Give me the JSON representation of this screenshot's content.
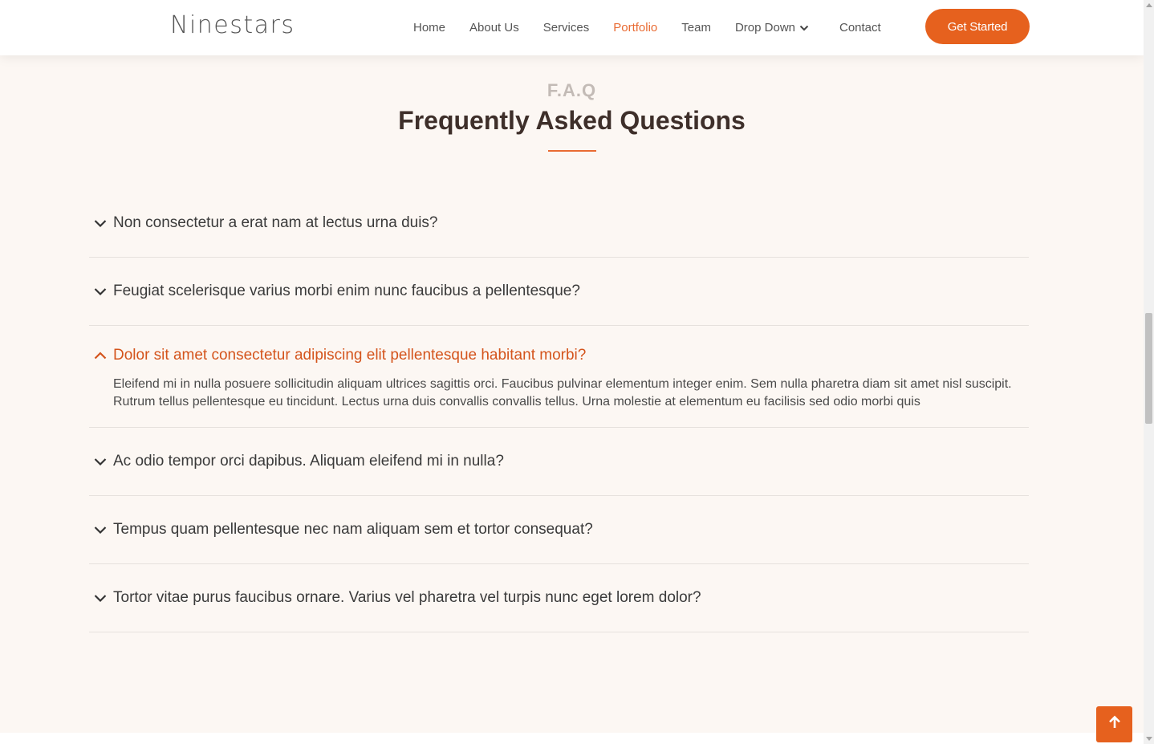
{
  "header": {
    "logo": "Ninestars",
    "nav": [
      {
        "label": "Home",
        "active": false
      },
      {
        "label": "About Us",
        "active": false
      },
      {
        "label": "Services",
        "active": false
      },
      {
        "label": "Portfolio",
        "active": true
      },
      {
        "label": "Team",
        "active": false
      },
      {
        "label": "Drop Down",
        "active": false,
        "icon": "chevron-down-icon"
      },
      {
        "label": "Contact",
        "active": false
      }
    ],
    "cta_label": "Get Started"
  },
  "section": {
    "kicker": "F.A.Q",
    "title": "Frequently Asked Questions"
  },
  "faq": [
    {
      "question": "Non consectetur a erat nam at lectus urna duis?",
      "open": false
    },
    {
      "question": "Feugiat scelerisque varius morbi enim nunc faucibus a pellentesque?",
      "open": false
    },
    {
      "question": "Dolor sit amet consectetur adipiscing elit pellentesque habitant morbi?",
      "open": true,
      "answer": "Eleifend mi in nulla posuere sollicitudin aliquam ultrices sagittis orci. Faucibus pulvinar elementum integer enim. Sem nulla pharetra diam sit amet nisl suscipit. Rutrum tellus pellentesque eu tincidunt. Lectus urna duis convallis convallis tellus. Urna molestie at elementum eu facilisis sed odio morbi quis"
    },
    {
      "question": "Ac odio tempor orci dapibus. Aliquam eleifend mi in nulla?",
      "open": false
    },
    {
      "question": "Tempus quam pellentesque nec nam aliquam sem et tortor consequat?",
      "open": false
    },
    {
      "question": "Tortor vitae purus faucibus ornare. Varius vel pharetra vel turpis nunc eget lorem dolor?",
      "open": false
    }
  ],
  "colors": {
    "accent": "#e6611e",
    "active_nav": "#e96b33",
    "open_question": "#d4541c",
    "background": "#fcf7f3",
    "title": "#3e2f2a"
  },
  "scroll_top_icon": "arrow-up-icon"
}
